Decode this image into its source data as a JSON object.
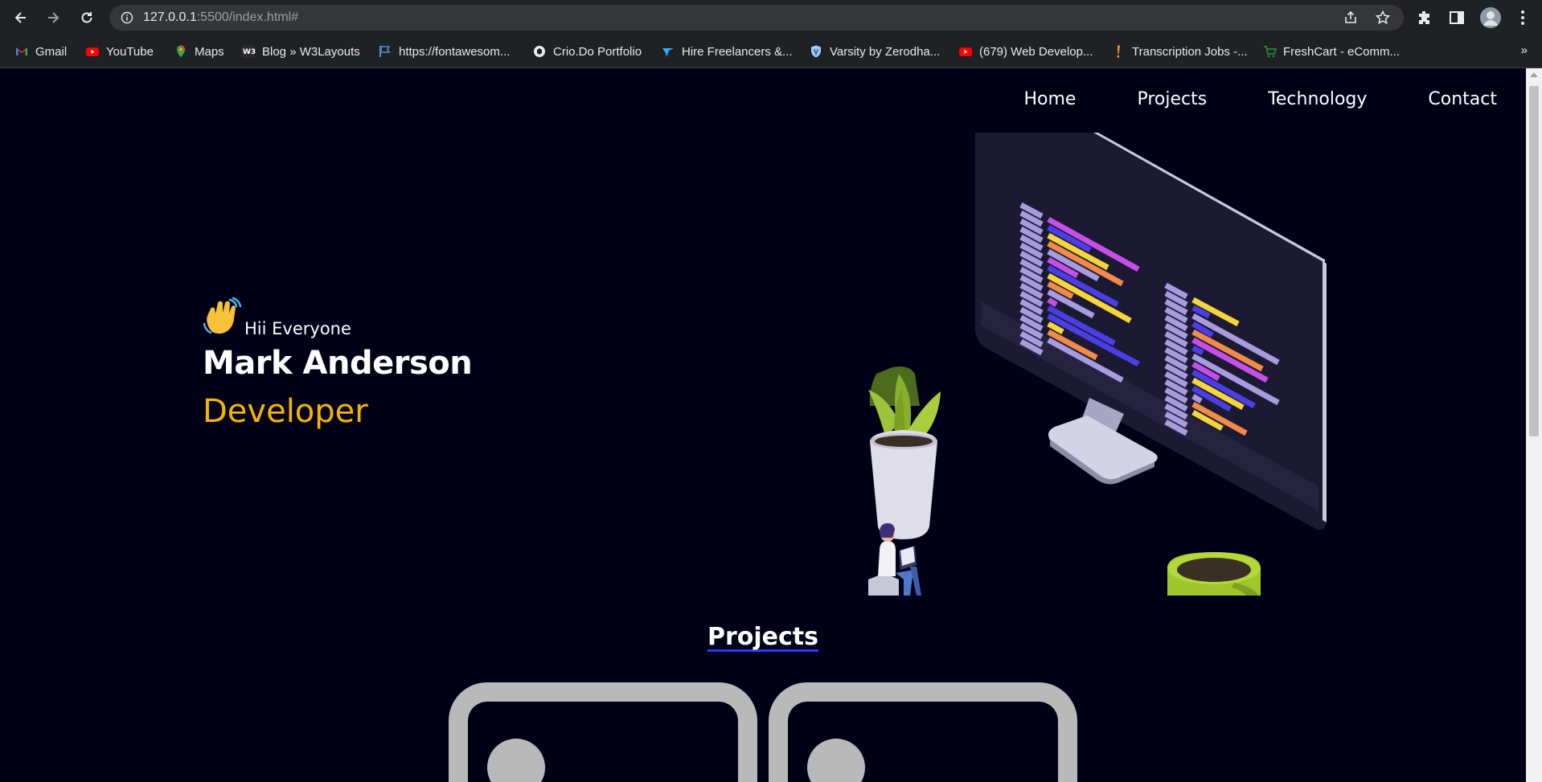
{
  "browser": {
    "url_host": "127.0.0.1",
    "url_rest": ":5500/index.html#",
    "bookmarks": [
      {
        "label": "Gmail",
        "icon": "gmail-icon"
      },
      {
        "label": "YouTube",
        "icon": "youtube-icon"
      },
      {
        "label": "Maps",
        "icon": "maps-icon"
      },
      {
        "label": "Blog » W3Layouts",
        "icon": "w3layouts-icon"
      },
      {
        "label": "https://fontawesom...",
        "icon": "flag-icon"
      },
      {
        "label": "Crio.Do Portfolio",
        "icon": "crio-icon"
      },
      {
        "label": "Hire Freelancers &...",
        "icon": "freelancer-icon"
      },
      {
        "label": "Varsity by Zerodha...",
        "icon": "varsity-icon"
      },
      {
        "label": "(679) Web Develop...",
        "icon": "youtube-icon"
      },
      {
        "label": "Transcription Jobs -...",
        "icon": "exclamation-icon"
      },
      {
        "label": "FreshCart - eComm...",
        "icon": "freshcart-icon"
      }
    ],
    "more_bookmarks": "»"
  },
  "site": {
    "nav": [
      "Home",
      "Projects",
      "Technology",
      "Contact"
    ],
    "hero": {
      "greeting": "Hii Everyone",
      "name": "Mark Anderson",
      "role": "Developer"
    },
    "projects_heading": "Projects"
  },
  "colors": {
    "page_bg": "#000117",
    "accent_yellow": "#f4b400",
    "underline_blue": "#2b3bff",
    "card_gray": "#b9b9b9"
  }
}
